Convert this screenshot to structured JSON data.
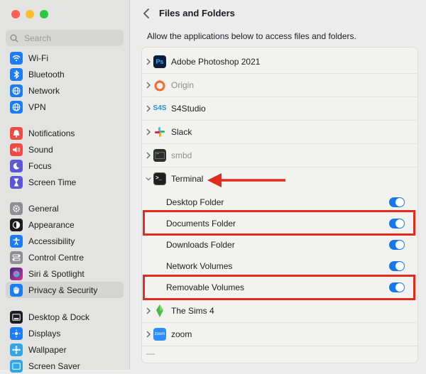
{
  "window": {
    "traffic_colors": [
      "#ff5f57",
      "#febc2e",
      "#28c840"
    ]
  },
  "sidebar": {
    "search_placeholder": "Search",
    "groups": [
      [
        {
          "label": "Wi-Fi",
          "icon": "wifi-icon",
          "color": "#1b7cf3"
        },
        {
          "label": "Bluetooth",
          "icon": "bluetooth-icon",
          "color": "#1b7cf3"
        },
        {
          "label": "Network",
          "icon": "globe-icon",
          "color": "#1b7cf3"
        },
        {
          "label": "VPN",
          "icon": "vpn-globe-icon",
          "color": "#1b7cf3"
        }
      ],
      [
        {
          "label": "Notifications",
          "icon": "bell-icon",
          "color": "#ef4b44"
        },
        {
          "label": "Sound",
          "icon": "speaker-icon",
          "color": "#ef4b44"
        },
        {
          "label": "Focus",
          "icon": "moon-icon",
          "color": "#5b57d6"
        },
        {
          "label": "Screen Time",
          "icon": "hourglass-icon",
          "color": "#5b57d6"
        }
      ],
      [
        {
          "label": "General",
          "icon": "gear-icon",
          "color": "#8e8e93"
        },
        {
          "label": "Appearance",
          "icon": "appearance-icon",
          "color": "#1d1d1f"
        },
        {
          "label": "Accessibility",
          "icon": "accessibility-icon",
          "color": "#1b7cf3"
        },
        {
          "label": "Control Centre",
          "icon": "control-centre-icon",
          "color": "#8e8e93"
        },
        {
          "label": "Siri & Spotlight",
          "icon": "siri-icon",
          "color": "#7a3fd9"
        },
        {
          "label": "Privacy & Security",
          "icon": "hand-icon",
          "color": "#1b7cf3"
        }
      ],
      [
        {
          "label": "Desktop & Dock",
          "icon": "dock-icon",
          "color": "#1d1d1f"
        },
        {
          "label": "Displays",
          "icon": "display-icon",
          "color": "#1b7cf3"
        },
        {
          "label": "Wallpaper",
          "icon": "wallpaper-icon",
          "color": "#31a6e8"
        },
        {
          "label": "Screen Saver",
          "icon": "screensaver-icon",
          "color": "#31a6e8"
        }
      ]
    ]
  },
  "main": {
    "title": "Files and Folders",
    "subtitle": "Allow the applications below to access files and folders.",
    "apps": [
      {
        "label": "Adobe Photoshop 2021",
        "icon_text": "Ps",
        "icon": "photoshop-icon",
        "color": "#0b1d3a",
        "dim": false
      },
      {
        "label": "Origin",
        "icon_text": "",
        "icon": "origin-icon",
        "color": "#f56c2d",
        "dim": true
      },
      {
        "label": "S4Studio",
        "icon_text": "S4S",
        "icon": "s4studio-icon",
        "color": "#2b8fd1",
        "dim": false
      },
      {
        "label": "Slack",
        "icon_text": "#",
        "icon": "slack-icon",
        "color": "#4a154b",
        "dim": false
      },
      {
        "label": "smbd",
        "icon_text": "",
        "icon": "terminal-exec-icon",
        "color": "#2d2d2d",
        "dim": true
      },
      {
        "label": "Terminal",
        "icon_text": ">_",
        "icon": "terminal-icon",
        "color": "#1f1f1f",
        "dim": false
      }
    ],
    "terminal_permissions": [
      {
        "label": "Desktop Folder",
        "enabled": true
      },
      {
        "label": "Documents Folder",
        "enabled": true
      },
      {
        "label": "Downloads Folder",
        "enabled": true
      },
      {
        "label": "Network Volumes",
        "enabled": true
      },
      {
        "label": "Removable Volumes",
        "enabled": true
      }
    ],
    "apps_after": [
      {
        "label": "The Sims 4",
        "icon_text": "",
        "icon": "sims-plumbob-icon",
        "color": "#4fb848",
        "dim": false
      },
      {
        "label": "zoom",
        "icon_text": "zoom",
        "icon": "zoom-icon",
        "color": "#2d8cff",
        "dim": false
      }
    ],
    "highlight_color": "#e32b1b",
    "remove_label": "—"
  }
}
